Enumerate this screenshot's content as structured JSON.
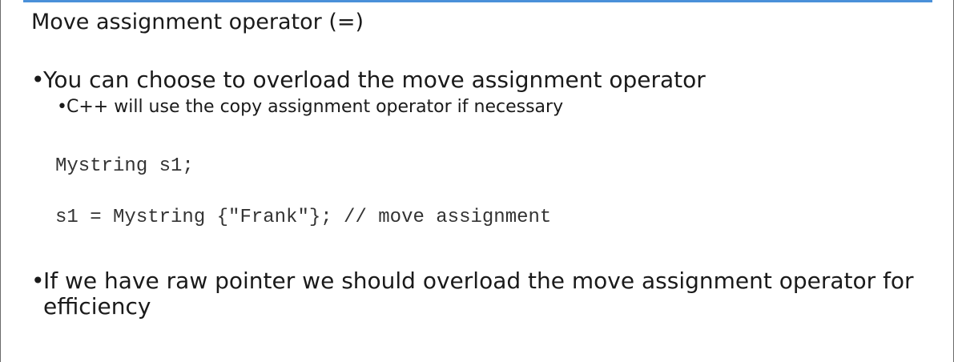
{
  "slide": {
    "title": "Move assignment operator (=)",
    "bullets": [
      {
        "text": "You can choose to overload the move assignment operator",
        "sub_bullets": [
          "C++ will use the copy assignment operator if necessary"
        ]
      },
      {
        "text": "If we have raw pointer we should overload the move assignment operator for efficiency"
      }
    ],
    "code_lines": [
      "Mystring s1;",
      "s1 = Mystring {\"Frank\"}; // move assignment"
    ],
    "bullet_glyph": "•",
    "accent_color": "#4a90d9"
  }
}
